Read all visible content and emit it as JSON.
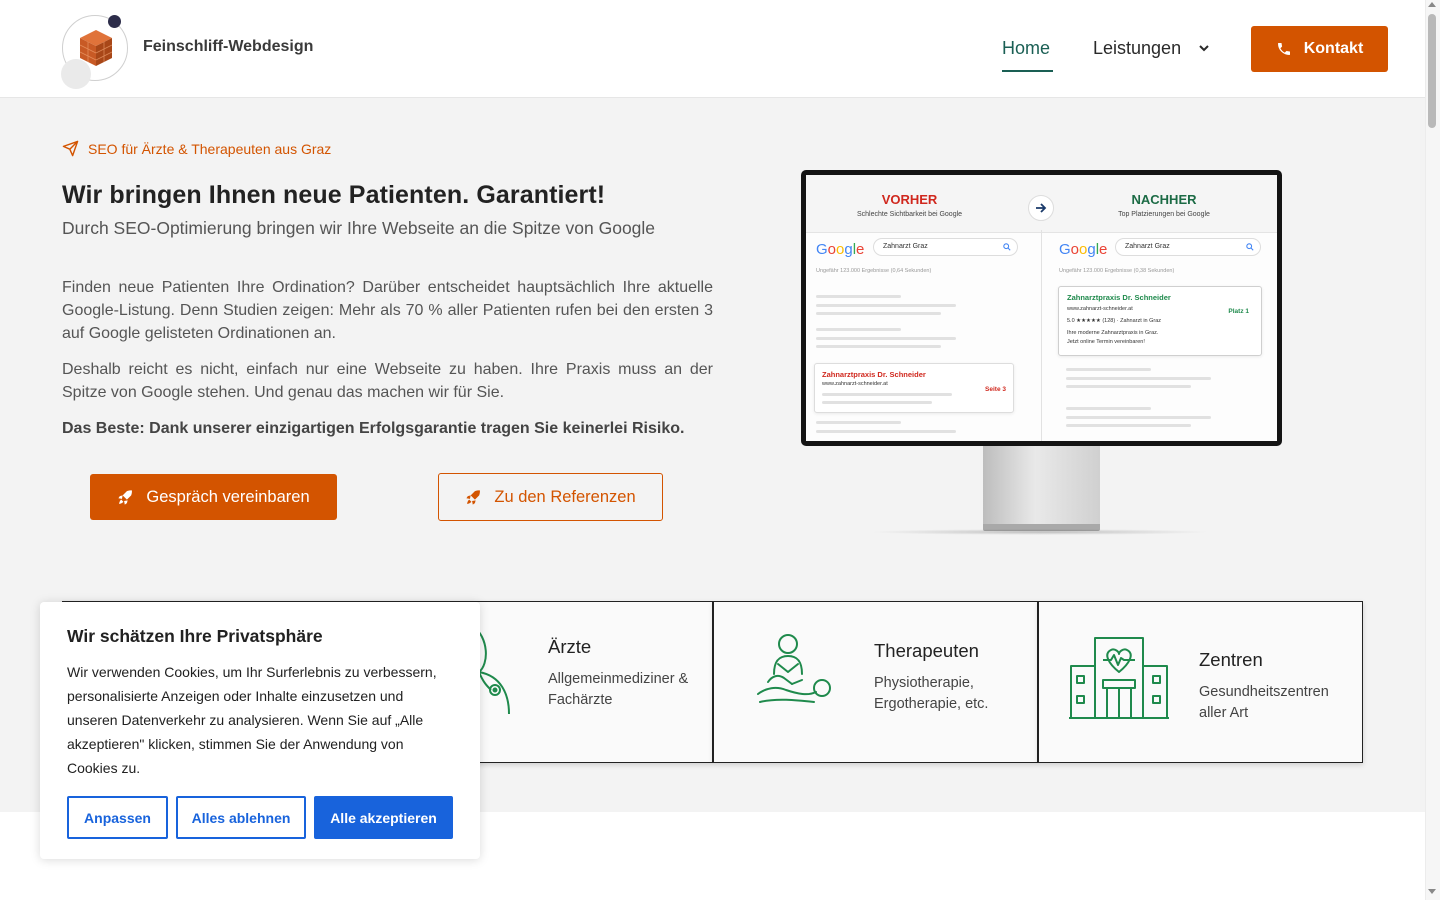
{
  "header": {
    "brand": "Feinschliff-Webdesign",
    "nav_home": "Home",
    "nav_leistungen": "Leistungen",
    "contact_button": "Kontakt"
  },
  "hero": {
    "tagline": "SEO für Ärzte & Therapeuten aus Graz",
    "title": "Wir bringen Ihnen neue Patienten. Garantiert!",
    "subtitle": "Durch SEO-Optimierung bringen wir Ihre Webseite an die Spitze von Google",
    "paragraph1": "Finden neue Patienten Ihre Ordination? Darüber entscheidet hauptsächlich Ihre aktuelle Google-Listung. Denn Studien zeigen: Mehr als 70 % aller Patienten rufen bei den ersten 3 auf Google gelisteten Ordinationen an.",
    "paragraph2": "Deshalb reicht es nicht, einfach nur eine Webseite zu haben. Ihre Praxis muss an der Spitze von Google stehen. Und genau das machen wir für Sie.",
    "paragraph3": "Das Beste: Dank unserer einzigartigen Erfolgsgarantie tragen Sie keinerlei Risiko.",
    "cta_primary": "Gespräch vereinbaren",
    "cta_secondary": "Zu den Referenzen"
  },
  "monitor": {
    "before_title": "VORHER",
    "before_sub": "Schlechte Sichtbarkeit bei Google",
    "after_title": "NACHHER",
    "after_sub": "Top Platzierungen bei Google",
    "google_word": "Google",
    "search_query": "Zahnarzt Graz",
    "before_count": "Ungefähr 123.000 Ergebnisse (0,64 Sekunden)",
    "after_count": "Ungefähr 123.000 Ergebnisse (0,38 Sekunden)",
    "before_result_title": "Zahnarztpraxis Dr. Schneider",
    "before_result_url": "www.zahnarzt-schneider.at",
    "before_rank": "Seite 3",
    "after_result_title": "Zahnarztpraxis Dr. Schneider",
    "after_result_url": "www.zahnarzt-schneider.at",
    "after_rating": "5.0 ★★★★★ (128) · Zahnarzt in Graz",
    "after_desc1": "Ihre moderne Zahnarztpraxis in Graz.",
    "after_desc2": "Jetzt online Termin vereinbaren!",
    "after_rank": "Platz 1"
  },
  "cards": [
    {
      "title": "Ärzte",
      "desc1": "Allgemeinmediziner &",
      "desc2": "Fachärzte"
    },
    {
      "title": "Therapeuten",
      "desc1": "Physiotherapie,",
      "desc2": "Ergotherapie, etc."
    },
    {
      "title": "Zentren",
      "desc1": "Gesundheitszentren",
      "desc2": "aller Art"
    }
  ],
  "cookie": {
    "title": "Wir schätzen Ihre Privatsphäre",
    "text": "Wir verwenden Cookies, um Ihr Surferlebnis zu verbessern, personalisierte Anzeigen oder Inhalte einzusetzen und unseren Datenverkehr zu analysieren. Wenn Sie auf „Alle akzeptieren\" klicken, stimmen Sie der Anwendung von Cookies zu.",
    "customize": "Anpassen",
    "reject": "Alles ablehnen",
    "accept": "Alle akzeptieren"
  },
  "colors": {
    "accent": "#d35400",
    "nav_active": "#1a5f54",
    "icon_green": "#1f8a4c",
    "cookie_blue": "#1863dc"
  },
  "icons": [
    "paper-plane-icon",
    "chevron-down-icon",
    "phone-icon",
    "rocket-icon",
    "doctor-icon",
    "therapist-icon",
    "hospital-icon",
    "search-icon",
    "arrow-right-icon"
  ]
}
